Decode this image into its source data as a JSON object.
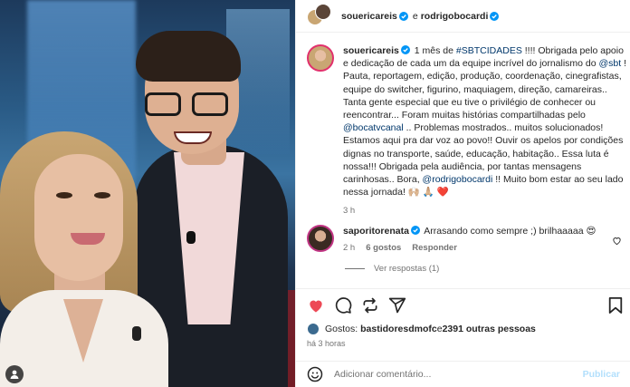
{
  "post": {
    "author": "souericareis",
    "conjunction": "e",
    "coauthor": "rodrigobocardi"
  },
  "caption": {
    "username": "souericareis",
    "segments": [
      {
        "type": "text",
        "value": " 1 mês de "
      },
      {
        "type": "link",
        "value": "#SBTCIDADES"
      },
      {
        "type": "text",
        "value": " !!!! Obrigada pelo apoio e dedicação de cada um da equipe incrível do jornalismo do "
      },
      {
        "type": "link",
        "value": "@sbt"
      },
      {
        "type": "text",
        "value": " ! Pauta, reportagem, edição, produção, coordenação, cinegrafistas, equipe do switcher, figurino, maquiagem, direção, camareiras.. Tanta gente especial que eu tive o privilégio de conhecer ou reencontrar... Foram muitas histórias compartilhadas pelo "
      },
      {
        "type": "link",
        "value": "@bocatvcanal"
      },
      {
        "type": "text",
        "value": " .. Problemas mostrados.. muitos solucionados! Estamos aqui pra dar voz ao povo!! Ouvir os apelos por condições dignas no transporte, saúde, educação, habitação.. Essa luta é nossa!!! Obrigada pela audiência, por tantas mensagens carinhosas.. Bora, "
      },
      {
        "type": "link",
        "value": "@rodrigobocardi"
      },
      {
        "type": "text",
        "value": " !! Muito bom estar ao seu lado nessa jornada! 🙌🏼 🙏🏼 ❤️"
      }
    ],
    "time": "3 h"
  },
  "reply": {
    "username": "saporitorenata",
    "text": " Arrasando como sempre ;) brilhaaaaa 😍",
    "time": "2 h",
    "likes": "6 gostos",
    "reply_label": "Responder"
  },
  "view_replies": "Ver respostas (1)",
  "likes": {
    "prefix": "Gostos: ",
    "user": "bastidoresdmofc",
    "suffix": " e ",
    "others": "2391 outras pessoas"
  },
  "posted_time": "há 3 horas",
  "add_comment": {
    "placeholder": "Adicionar comentário...",
    "publish_label": "Publicar"
  },
  "colors": {
    "like_red": "#ed4956",
    "link_blue": "#00376b",
    "verified_blue": "#0095f6",
    "publish_disabled": "#b2dffc"
  },
  "icons": [
    "verified-badge-icon",
    "heart-icon",
    "comment-icon",
    "repost-icon",
    "share-icon",
    "bookmark-icon",
    "emoji-icon",
    "user-tag-icon"
  ]
}
